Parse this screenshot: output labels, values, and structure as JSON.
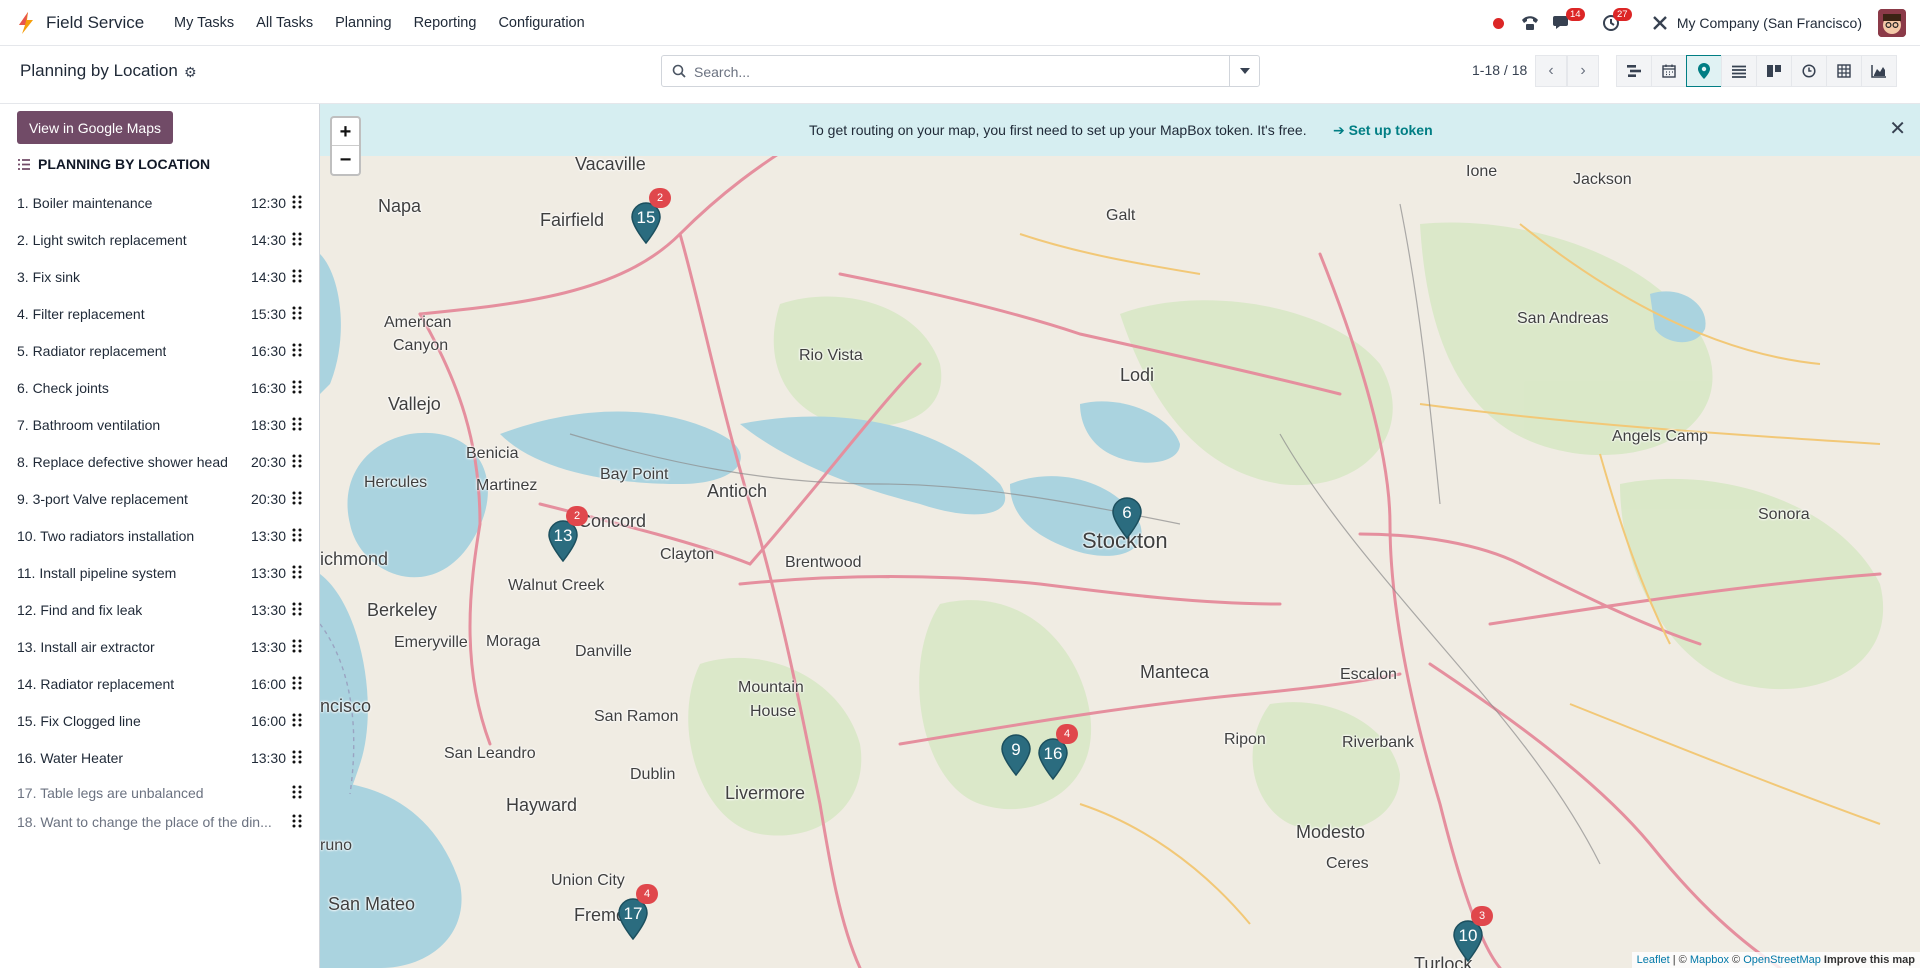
{
  "navbar": {
    "app_name": "Field Service",
    "menu": [
      "My Tasks",
      "All Tasks",
      "Planning",
      "Reporting",
      "Configuration"
    ],
    "messages_count": "14",
    "activities_count": "27",
    "company": "My Company (San Francisco)"
  },
  "control_panel": {
    "title": "Planning by Location",
    "search_placeholder": "Search...",
    "pager": "1-18 / 18",
    "views": [
      "list-icon",
      "calendar-icon",
      "map-marker-icon",
      "list-lines-icon",
      "kanban-icon",
      "clock-icon",
      "pivot-icon",
      "graph-icon"
    ],
    "active_view": "map-marker-icon"
  },
  "sidebar": {
    "google_maps_button": "View in Google Maps",
    "header": "PLANNING BY LOCATION",
    "records": [
      {
        "label": "1. Boiler maintenance",
        "time": "12:30"
      },
      {
        "label": "2. Light switch replacement",
        "time": "14:30"
      },
      {
        "label": "3. Fix sink",
        "time": "14:30"
      },
      {
        "label": "4. Filter replacement",
        "time": "15:30"
      },
      {
        "label": "5. Radiator replacement",
        "time": "16:30"
      },
      {
        "label": "6. Check joints",
        "time": "16:30"
      },
      {
        "label": "7. Bathroom ventilation",
        "time": "18:30"
      },
      {
        "label": "8. Replace defective shower head",
        "time": "20:30"
      },
      {
        "label": "9. 3-port Valve replacement",
        "time": "20:30"
      },
      {
        "label": "10. Two radiators installation",
        "time": "13:30"
      },
      {
        "label": "11. Install pipeline system",
        "time": "13:30"
      },
      {
        "label": "12. Find and fix leak",
        "time": "13:30"
      },
      {
        "label": "13. Install air extractor",
        "time": "13:30"
      },
      {
        "label": "14. Radiator replacement",
        "time": "16:00"
      },
      {
        "label": "15. Fix Clogged line",
        "time": "16:00"
      },
      {
        "label": "16. Water Heater",
        "time": "13:30"
      }
    ],
    "unscheduled": [
      {
        "label": "17. Table legs are unbalanced"
      },
      {
        "label": "18. Want to change the place of the din..."
      }
    ]
  },
  "map": {
    "banner_text": "To get routing on your map, you first need to set up your MapBox token. It's free.",
    "banner_link": "➔ Set up token",
    "zoom_in": "+",
    "zoom_out": "−",
    "places": [
      "Vacaville",
      "Napa",
      "Fairfield",
      "Galt",
      "Ione",
      "Jackson",
      "American",
      "Canyon",
      "Rio Vista",
      "Lodi",
      "San Andreas",
      "Vallejo",
      "Angels Camp",
      "Benicia",
      "Hercules",
      "Martinez",
      "Bay Point",
      "Antioch",
      "Concord",
      "Clayton",
      "Brentwood",
      "Stockton",
      "Sonora",
      "ichmond",
      "Walnut Creek",
      "Berkeley",
      "Emeryville",
      "Moraga",
      "Danville",
      "Mountain",
      "House",
      "Manteca",
      "Escalon",
      "ncisco",
      "San Ramon",
      "Ripon",
      "Riverbank",
      "San Leandro",
      "Dublin",
      "Livermore",
      "Hayward",
      "Modesto",
      "Ceres",
      "runo",
      "Union City",
      "San Mateo",
      "Fremont",
      "Turlock"
    ],
    "markers": [
      {
        "number": "15",
        "count": "2"
      },
      {
        "number": "13",
        "count": "2"
      },
      {
        "number": "6",
        "count": ""
      },
      {
        "number": "9",
        "count": ""
      },
      {
        "number": "16",
        "count": "4"
      },
      {
        "number": "17",
        "count": "4"
      },
      {
        "number": "10",
        "count": "3"
      }
    ],
    "attribution": {
      "leaflet": "Leaflet",
      "mapbox": "Mapbox",
      "osm": "OpenStreetMap",
      "improve": "Improve this map"
    }
  },
  "colors": {
    "brand": "#714b67",
    "accent": "#017e84",
    "marker": "#2b6c7f",
    "badge": "#dc2626"
  }
}
